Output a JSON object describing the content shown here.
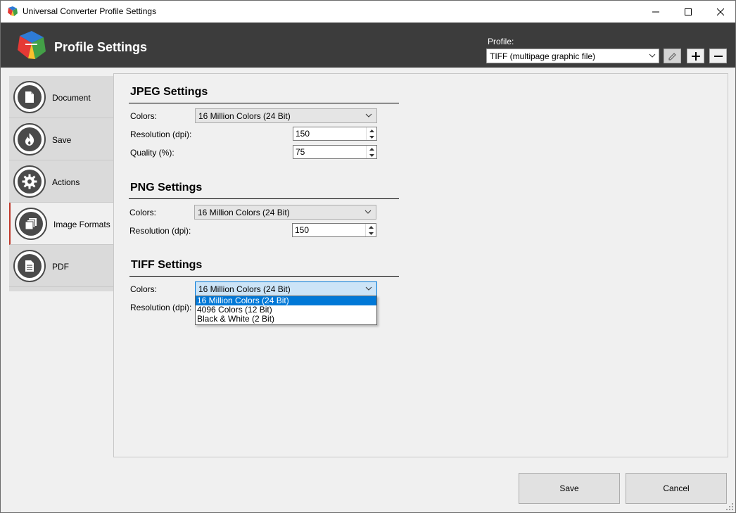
{
  "window": {
    "title": "Universal Converter Profile Settings",
    "controls": [
      "minimize",
      "maximize",
      "close"
    ]
  },
  "header": {
    "heading": "Profile Settings",
    "profile_label": "Profile:",
    "profile_value": "TIFF (multipage graphic file)",
    "buttons": [
      "edit-icon",
      "plus-icon",
      "minus-icon"
    ]
  },
  "sidebar": {
    "items": [
      {
        "label": "Document",
        "icon": "document-icon"
      },
      {
        "label": "Save",
        "icon": "flame-icon"
      },
      {
        "label": "Actions",
        "icon": "gear-icon"
      },
      {
        "label": "Image Formats",
        "icon": "images-icon",
        "active": true
      },
      {
        "label": "PDF",
        "icon": "pdf-file-icon"
      }
    ]
  },
  "jpeg": {
    "title": "JPEG Settings",
    "colors_label": "Colors:",
    "colors_value": "16 Million Colors (24 Bit)",
    "resolution_label": "Resolution (dpi):",
    "resolution_value": "150",
    "quality_label": "Quality (%):",
    "quality_value": "75"
  },
  "png": {
    "title": "PNG Settings",
    "colors_label": "Colors:",
    "colors_value": "16 Million Colors (24 Bit)",
    "resolution_label": "Resolution (dpi):",
    "resolution_value": "150"
  },
  "tiff": {
    "title": "TIFF Settings",
    "colors_label": "Colors:",
    "colors_value": "16 Million Colors (24 Bit)",
    "resolution_label": "Resolution (dpi):",
    "dropdown_options": [
      "16 Million Colors (24 Bit)",
      "4096 Colors (12 Bit)",
      "Black & White (2 Bit)"
    ]
  },
  "footer": {
    "save_label": "Save",
    "cancel_label": "Cancel"
  },
  "colors": {
    "header_bg": "#3c3c3c",
    "active_accent": "#c0392b",
    "selection": "#0078d7"
  }
}
